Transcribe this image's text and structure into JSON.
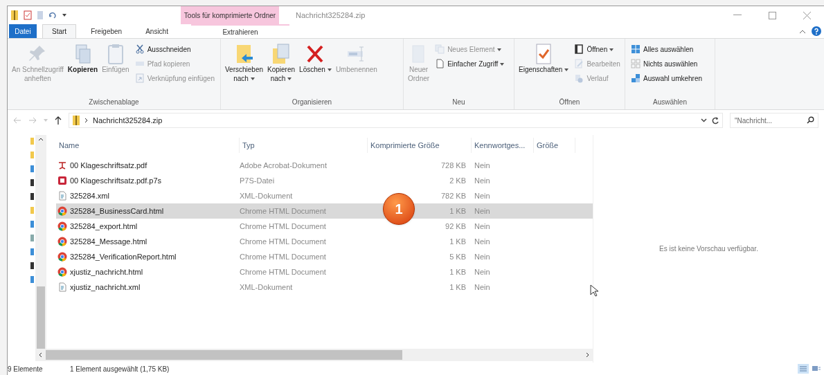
{
  "window": {
    "title": "Nachricht325284.zip",
    "context_tab_group": "Tools für komprimierte Ordner"
  },
  "tabs": [
    {
      "label": "Datei",
      "kind": "file",
      "selected": false
    },
    {
      "label": "Start",
      "kind": "normal",
      "selected": true
    },
    {
      "label": "Freigeben",
      "kind": "normal",
      "selected": false
    },
    {
      "label": "Ansicht",
      "kind": "normal",
      "selected": false
    },
    {
      "label": "Extrahieren",
      "kind": "context",
      "selected": false
    }
  ],
  "ribbon": {
    "groups": [
      {
        "label": "Zwischenablage",
        "items": [
          {
            "kind": "large",
            "lines": [
              "An Schnellzugriff",
              "anheften"
            ],
            "disabled": true,
            "bold": false,
            "dropdown": false
          },
          {
            "kind": "large",
            "lines": [
              "Kopieren"
            ],
            "disabled": false,
            "bold": true,
            "dropdown": false
          },
          {
            "kind": "large",
            "lines": [
              "Einfügen"
            ],
            "disabled": true,
            "bold": false,
            "dropdown": false
          },
          {
            "kind": "small",
            "lines": [
              "Ausschneiden"
            ],
            "disabled": false,
            "bold": false,
            "dropdown": false
          },
          {
            "kind": "small",
            "lines": [
              "Pfad kopieren"
            ],
            "disabled": true,
            "bold": false,
            "dropdown": false
          },
          {
            "kind": "small",
            "lines": [
              "Verknüpfung einfügen"
            ],
            "disabled": true,
            "bold": false,
            "dropdown": false
          }
        ]
      },
      {
        "label": "Organisieren",
        "items": [
          {
            "kind": "large",
            "lines": [
              "Verschieben",
              "nach"
            ],
            "disabled": false,
            "bold": false,
            "dropdown": true
          },
          {
            "kind": "large",
            "lines": [
              "Kopieren",
              "nach"
            ],
            "disabled": false,
            "bold": false,
            "dropdown": true
          },
          {
            "kind": "large",
            "lines": [
              "Löschen"
            ],
            "disabled": false,
            "bold": false,
            "dropdown": true
          },
          {
            "kind": "large",
            "lines": [
              "Umbenennen"
            ],
            "disabled": true,
            "bold": false,
            "dropdown": false
          }
        ]
      },
      {
        "label": "Neu",
        "items": [
          {
            "kind": "large",
            "lines": [
              "Neuer",
              "Ordner"
            ],
            "disabled": true,
            "bold": false,
            "dropdown": false
          },
          {
            "kind": "small",
            "lines": [
              "Neues Element"
            ],
            "disabled": true,
            "bold": false,
            "dropdown": true
          },
          {
            "kind": "small",
            "lines": [
              "Einfacher Zugriff"
            ],
            "disabled": false,
            "bold": false,
            "dropdown": true
          }
        ]
      },
      {
        "label": "Öffnen",
        "items": [
          {
            "kind": "large",
            "lines": [
              "Eigenschaften"
            ],
            "disabled": false,
            "bold": false,
            "dropdown": true
          },
          {
            "kind": "small",
            "lines": [
              "Öffnen"
            ],
            "disabled": false,
            "bold": false,
            "dropdown": true
          },
          {
            "kind": "small",
            "lines": [
              "Bearbeiten"
            ],
            "disabled": true,
            "bold": false,
            "dropdown": false
          },
          {
            "kind": "small",
            "lines": [
              "Verlauf"
            ],
            "disabled": true,
            "bold": false,
            "dropdown": false
          }
        ]
      },
      {
        "label": "Auswählen",
        "items": [
          {
            "kind": "small",
            "lines": [
              "Alles auswählen"
            ],
            "disabled": false,
            "bold": false,
            "dropdown": false
          },
          {
            "kind": "small",
            "lines": [
              "Nichts auswählen"
            ],
            "disabled": false,
            "bold": false,
            "dropdown": false
          },
          {
            "kind": "small",
            "lines": [
              "Auswahl umkehren"
            ],
            "disabled": false,
            "bold": false,
            "dropdown": false
          }
        ]
      }
    ]
  },
  "address_bar": {
    "path": "Nachricht325284.zip",
    "search": {
      "placeholder": "\"Nachricht..."
    }
  },
  "table": {
    "columns": [
      "Name",
      "Typ",
      "Komprimierte Größe",
      "Kennwortges...",
      "Größe"
    ],
    "rows": [
      {
        "kind": "pdf",
        "name": "00 Klageschriftsatz.pdf",
        "type": "Adobe Acrobat-Dokument",
        "compressed": "728 KB",
        "password": "Nein",
        "selected": false
      },
      {
        "kind": "signature",
        "name": "00 Klageschriftsatz.pdf.p7s",
        "type": "P7S-Datei",
        "compressed": "2 KB",
        "password": "Nein",
        "selected": false
      },
      {
        "kind": "xml",
        "name": "325284.xml",
        "type": "XML-Dokument",
        "compressed": "782 KB",
        "password": "Nein",
        "selected": false
      },
      {
        "kind": "chrome",
        "name": "325284_BusinessCard.html",
        "type": "Chrome HTML Document",
        "compressed": "1 KB",
        "password": "Nein",
        "selected": true
      },
      {
        "kind": "chrome",
        "name": "325284_export.html",
        "type": "Chrome HTML Document",
        "compressed": "92 KB",
        "password": "Nein",
        "selected": false
      },
      {
        "kind": "chrome",
        "name": "325284_Message.html",
        "type": "Chrome HTML Document",
        "compressed": "1 KB",
        "password": "Nein",
        "selected": false
      },
      {
        "kind": "chrome",
        "name": "325284_VerificationReport.html",
        "type": "Chrome HTML Document",
        "compressed": "5 KB",
        "password": "Nein",
        "selected": false
      },
      {
        "kind": "chrome",
        "name": "xjustiz_nachricht.html",
        "type": "Chrome HTML Document",
        "compressed": "1 KB",
        "password": "Nein",
        "selected": false
      },
      {
        "kind": "xml",
        "name": "xjustiz_nachricht.xml",
        "type": "XML-Dokument",
        "compressed": "1 KB",
        "password": "Nein",
        "selected": false
      }
    ]
  },
  "step_marker": "1",
  "preview": {
    "message": "Es ist keine Vorschau verfügbar."
  },
  "status_bar": {
    "count": "9 Elemente",
    "selection": "1 Element ausgewählt (1,75 KB)"
  }
}
